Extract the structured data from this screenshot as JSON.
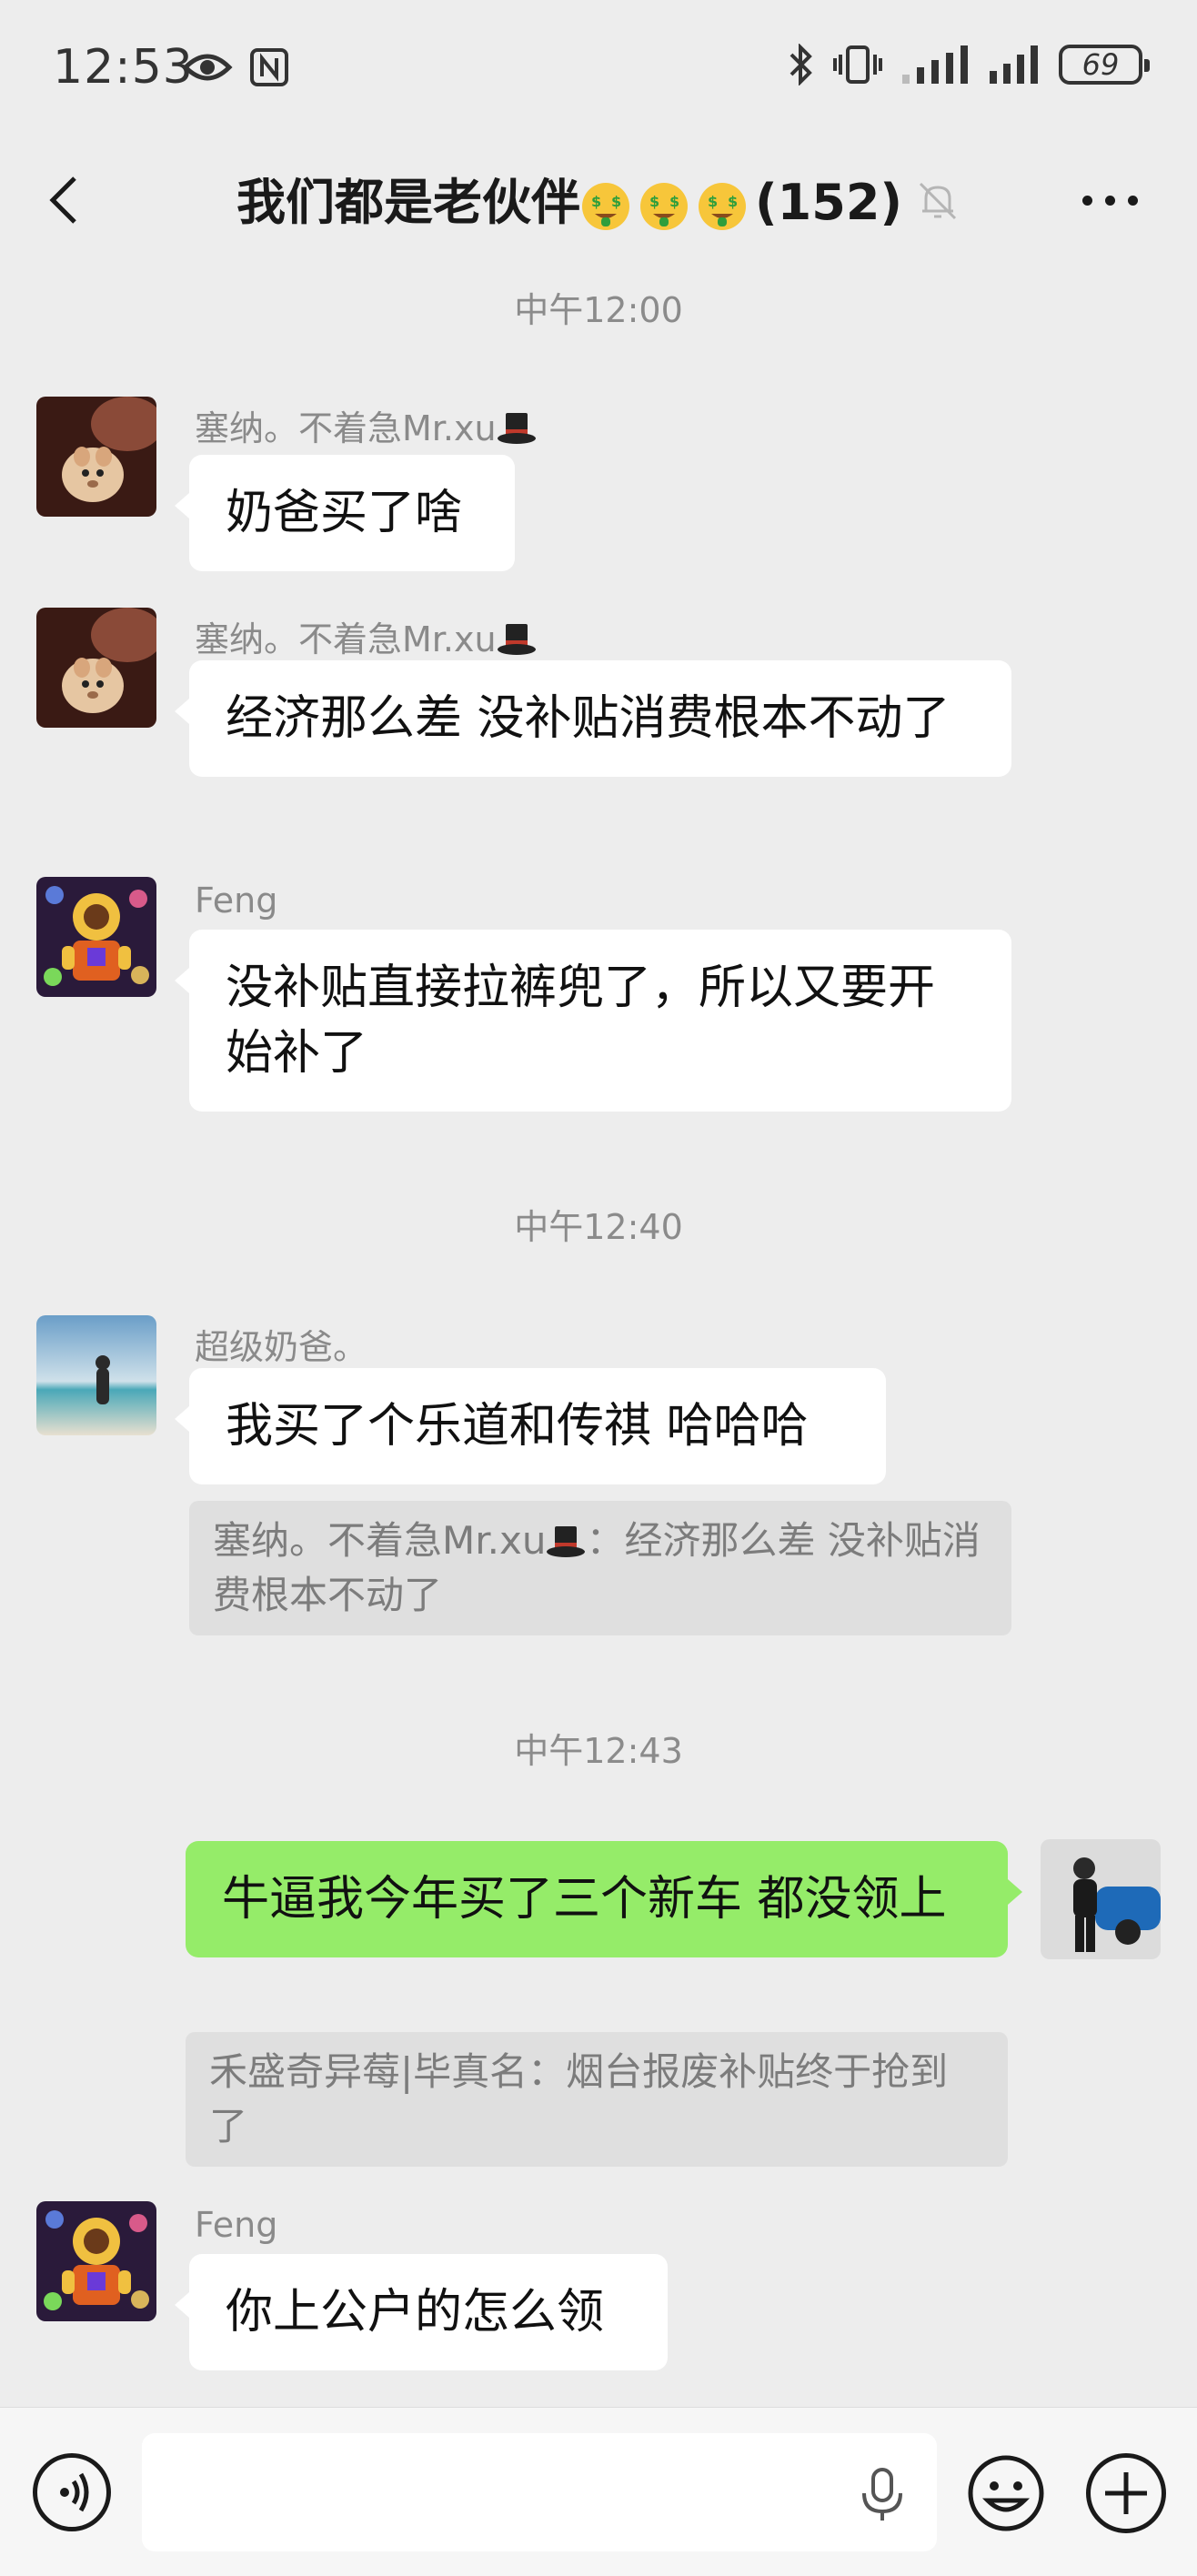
{
  "status_bar": {
    "time": "12:53",
    "battery": "69"
  },
  "header": {
    "title": "我们都是老伙伴",
    "member_count": "(152)"
  },
  "messages": [
    {
      "type": "time",
      "text": "中午12:00"
    },
    {
      "type": "text",
      "sender": "塞纳。不着急Mr.xu",
      "text": "奶爸买了啥"
    },
    {
      "type": "text",
      "sender": "塞纳。不着急Mr.xu",
      "text": "经济那么差 没补贴消费根本不动了"
    },
    {
      "type": "text",
      "sender": "Feng",
      "text": "没补贴直接拉裤兜了，所以又要开始补了"
    },
    {
      "type": "time",
      "text": "中午12:40"
    },
    {
      "type": "text",
      "sender": "超级奶爸。",
      "text": "我买了个乐道和传祺 哈哈哈",
      "quote_sender": "塞纳。不着急Mr.xu",
      "quote_text": "：经济那么差 没补贴消费根本不动了"
    },
    {
      "type": "time",
      "text": "中午12:43"
    },
    {
      "type": "text",
      "sender": "me",
      "text": "牛逼我今年买了三个新车 都没领上",
      "quote_text": "禾盛奇异莓|毕真名：烟台报废补贴终于抢到了"
    },
    {
      "type": "text",
      "sender": "Feng",
      "text": "你上公户的怎么领"
    }
  ],
  "colors": {
    "background": "#ededed",
    "mine_bubble": "#95ec69",
    "other_bubble": "#ffffff",
    "quote_bg": "#dfdfdf"
  },
  "icons": [
    "back-arrow-icon",
    "mute-bell-icon",
    "more-icon",
    "voice-icon",
    "mic-icon",
    "emoji-icon",
    "plus-icon"
  ]
}
